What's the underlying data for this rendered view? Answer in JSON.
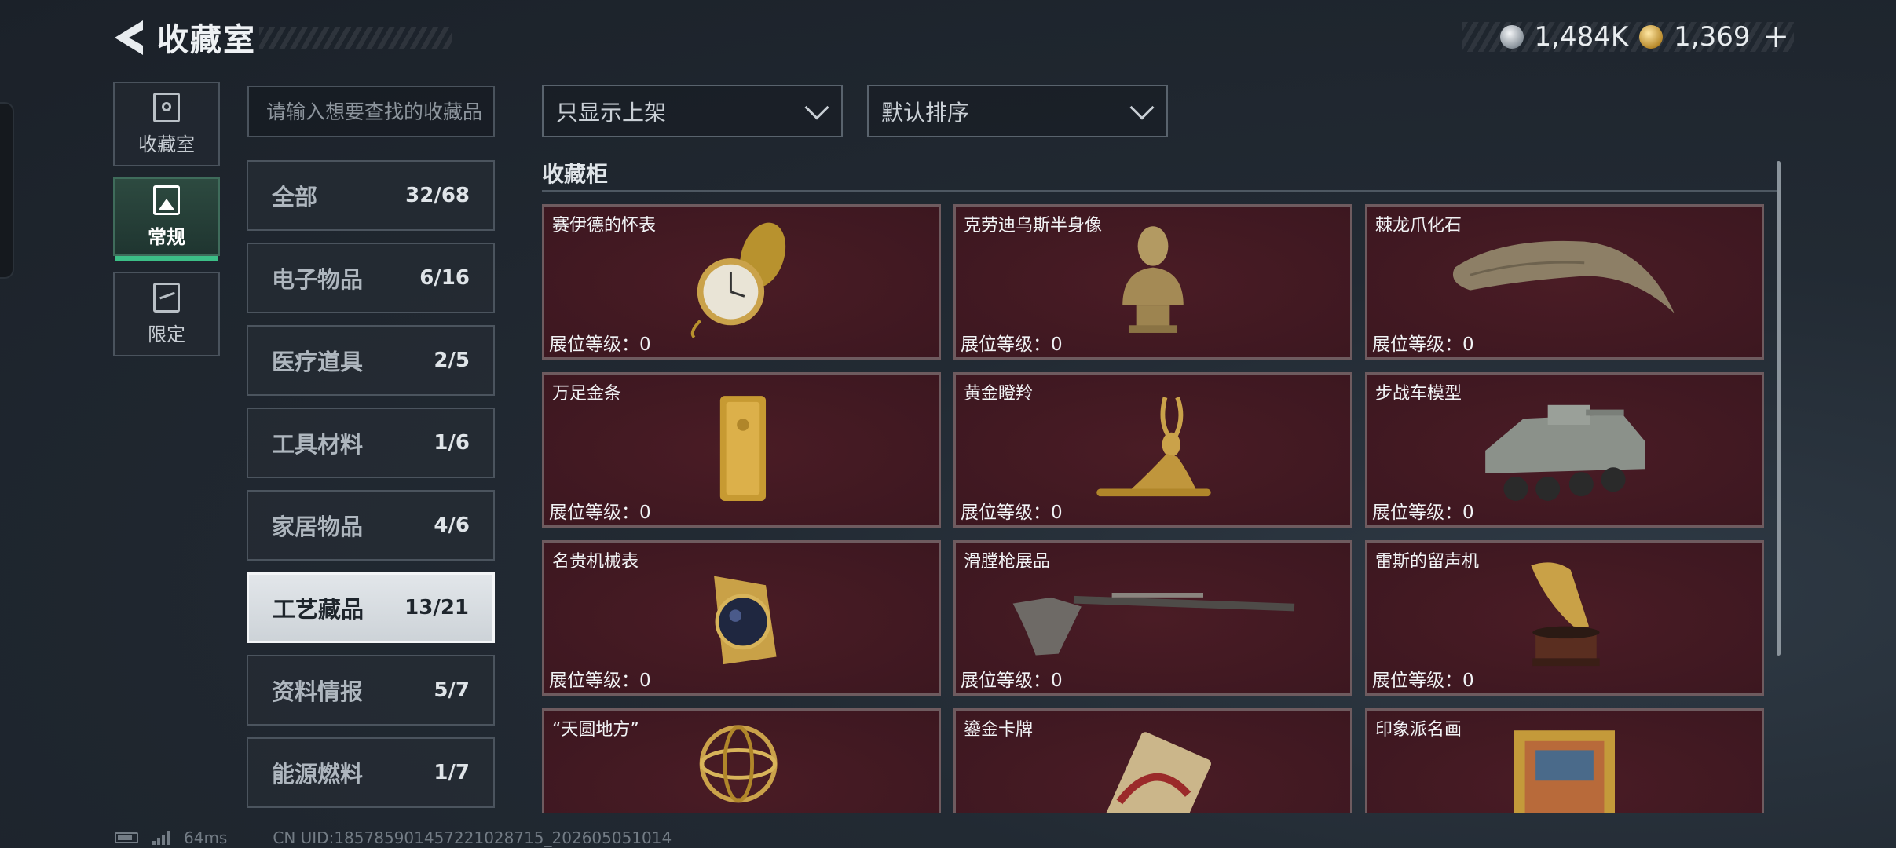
{
  "header": {
    "title": "收藏室",
    "currency": [
      {
        "icon": "silver-coin-icon",
        "value": "1,484K"
      },
      {
        "icon": "gold-coin-icon",
        "value": "1,369"
      }
    ],
    "add_label": "+"
  },
  "side_tabs": [
    {
      "label": "收藏室",
      "icon": "collection-room-icon",
      "active": false
    },
    {
      "label": "常规",
      "icon": "regular-icon",
      "active": true
    },
    {
      "label": "限定",
      "icon": "limited-icon",
      "active": false
    }
  ],
  "search": {
    "placeholder": "请输入想要查找的收藏品"
  },
  "categories": [
    {
      "name": "全部",
      "count": "32/68"
    },
    {
      "name": "电子物品",
      "count": "6/16"
    },
    {
      "name": "医疗道具",
      "count": "2/5"
    },
    {
      "name": "工具材料",
      "count": "1/6"
    },
    {
      "name": "家居物品",
      "count": "4/6"
    },
    {
      "name": "工艺藏品",
      "count": "13/21",
      "active": true
    },
    {
      "name": "资料情报",
      "count": "5/7"
    },
    {
      "name": "能源燃料",
      "count": "1/7"
    }
  ],
  "filters": {
    "show_filter": "只显示上架",
    "sort": "默认排序"
  },
  "section_title": "收藏柜",
  "cards": [
    {
      "name": "赛伊德的怀表",
      "level": "展位等级：0",
      "icon": "pocket-watch-icon"
    },
    {
      "name": "克劳迪乌斯半身像",
      "level": "展位等级：0",
      "icon": "bust-statue-icon"
    },
    {
      "name": "棘龙爪化石",
      "level": "展位等级：0",
      "icon": "claw-fossil-icon"
    },
    {
      "name": "万足金条",
      "level": "展位等级：0",
      "icon": "gold-bar-icon"
    },
    {
      "name": "黄金瞪羚",
      "level": "展位等级：0",
      "icon": "golden-gazelle-icon"
    },
    {
      "name": "步战车模型",
      "level": "展位等级：0",
      "icon": "ifv-model-icon"
    },
    {
      "name": "名贵机械表",
      "level": "展位等级：0",
      "icon": "wristwatch-icon"
    },
    {
      "name": "滑膛枪展品",
      "level": "展位等级：0",
      "icon": "musket-icon"
    },
    {
      "name": "雷斯的留声机",
      "level": "展位等级：0",
      "icon": "gramophone-icon"
    },
    {
      "name": "“天圆地方”",
      "level": "",
      "icon": "armillary-sphere-icon"
    },
    {
      "name": "鎏金卡牌",
      "level": "",
      "icon": "gilded-card-icon"
    },
    {
      "name": "印象派名画",
      "level": "",
      "icon": "painting-icon"
    }
  ],
  "footer": {
    "ping": "64ms",
    "uid": "CN UID:18578590145722102871​5_202605051014"
  }
}
